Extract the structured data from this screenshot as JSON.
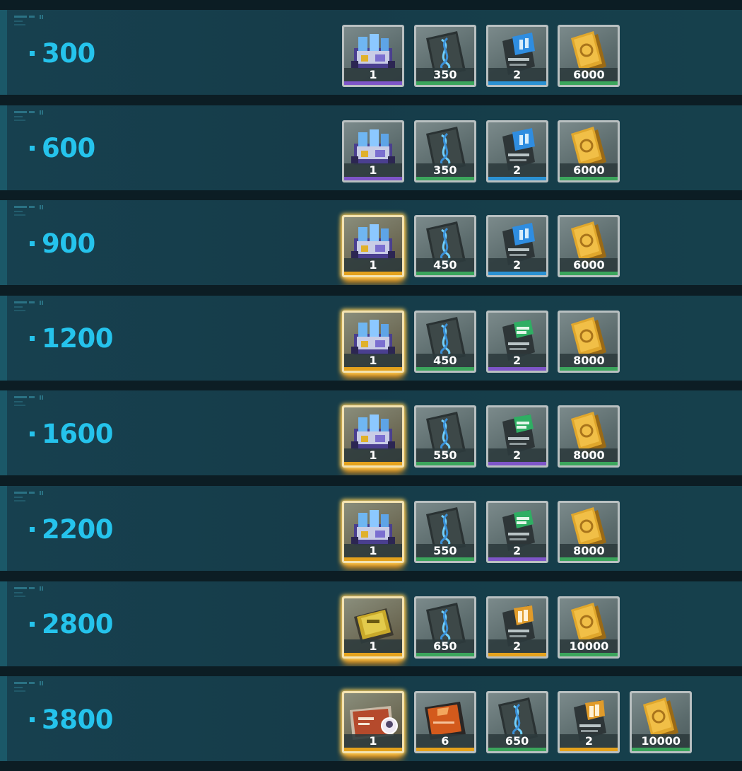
{
  "rarity_colors": {
    "purple": "#7e55c8",
    "green": "#3ba55c",
    "blue": "#2b91d2",
    "gold": "#e4a21d"
  },
  "tiers": [
    {
      "threshold": "300",
      "rewards": [
        {
          "icon": "mech-crate-icon",
          "qty": "1",
          "rarity": "purple",
          "glow": false
        },
        {
          "icon": "dna-dossier-icon",
          "qty": "350",
          "rarity": "green",
          "glow": false
        },
        {
          "icon": "blue-data-card-icon",
          "qty": "2",
          "rarity": "blue",
          "glow": false
        },
        {
          "icon": "gold-credit-icon",
          "qty": "6000",
          "rarity": "green",
          "glow": false
        }
      ]
    },
    {
      "threshold": "600",
      "rewards": [
        {
          "icon": "mech-crate-icon",
          "qty": "1",
          "rarity": "purple",
          "glow": false
        },
        {
          "icon": "dna-dossier-icon",
          "qty": "350",
          "rarity": "green",
          "glow": false
        },
        {
          "icon": "blue-data-card-icon",
          "qty": "2",
          "rarity": "blue",
          "glow": false
        },
        {
          "icon": "gold-credit-icon",
          "qty": "6000",
          "rarity": "green",
          "glow": false
        }
      ]
    },
    {
      "threshold": "900",
      "rewards": [
        {
          "icon": "mech-crate-icon",
          "qty": "1",
          "rarity": "gold",
          "glow": true
        },
        {
          "icon": "dna-dossier-icon",
          "qty": "450",
          "rarity": "green",
          "glow": false
        },
        {
          "icon": "blue-data-card-icon",
          "qty": "2",
          "rarity": "blue",
          "glow": false
        },
        {
          "icon": "gold-credit-icon",
          "qty": "6000",
          "rarity": "green",
          "glow": false
        }
      ]
    },
    {
      "threshold": "1200",
      "rewards": [
        {
          "icon": "mech-crate-icon",
          "qty": "1",
          "rarity": "gold",
          "glow": true
        },
        {
          "icon": "dna-dossier-icon",
          "qty": "450",
          "rarity": "green",
          "glow": false
        },
        {
          "icon": "green-data-card-icon",
          "qty": "2",
          "rarity": "purple",
          "glow": false
        },
        {
          "icon": "gold-credit-icon",
          "qty": "8000",
          "rarity": "green",
          "glow": false
        }
      ]
    },
    {
      "threshold": "1600",
      "rewards": [
        {
          "icon": "mech-crate-icon",
          "qty": "1",
          "rarity": "gold",
          "glow": true
        },
        {
          "icon": "dna-dossier-icon",
          "qty": "550",
          "rarity": "green",
          "glow": false
        },
        {
          "icon": "green-data-card-icon",
          "qty": "2",
          "rarity": "purple",
          "glow": false
        },
        {
          "icon": "gold-credit-icon",
          "qty": "8000",
          "rarity": "green",
          "glow": false
        }
      ]
    },
    {
      "threshold": "2200",
      "rewards": [
        {
          "icon": "mech-crate-icon",
          "qty": "1",
          "rarity": "gold",
          "glow": true
        },
        {
          "icon": "dna-dossier-icon",
          "qty": "550",
          "rarity": "green",
          "glow": false
        },
        {
          "icon": "green-data-card-icon",
          "qty": "2",
          "rarity": "purple",
          "glow": false
        },
        {
          "icon": "gold-credit-icon",
          "qty": "8000",
          "rarity": "green",
          "glow": false
        }
      ]
    },
    {
      "threshold": "2800",
      "rewards": [
        {
          "icon": "gold-chip-icon",
          "qty": "1",
          "rarity": "gold",
          "glow": true
        },
        {
          "icon": "dna-dossier-icon",
          "qty": "650",
          "rarity": "green",
          "glow": false
        },
        {
          "icon": "orange-data-card-icon",
          "qty": "2",
          "rarity": "gold",
          "glow": false
        },
        {
          "icon": "gold-credit-icon",
          "qty": "10000",
          "rarity": "green",
          "glow": false
        }
      ]
    },
    {
      "threshold": "3800",
      "rewards": [
        {
          "icon": "character-ticket-icon",
          "qty": "1",
          "rarity": "gold",
          "glow": true
        },
        {
          "icon": "orange-module-icon",
          "qty": "6",
          "rarity": "gold",
          "glow": false
        },
        {
          "icon": "dna-dossier-icon",
          "qty": "650",
          "rarity": "green",
          "glow": false
        },
        {
          "icon": "orange-data-card-icon",
          "qty": "2",
          "rarity": "gold",
          "glow": false
        },
        {
          "icon": "gold-credit-icon",
          "qty": "10000",
          "rarity": "green",
          "glow": false
        }
      ]
    }
  ]
}
